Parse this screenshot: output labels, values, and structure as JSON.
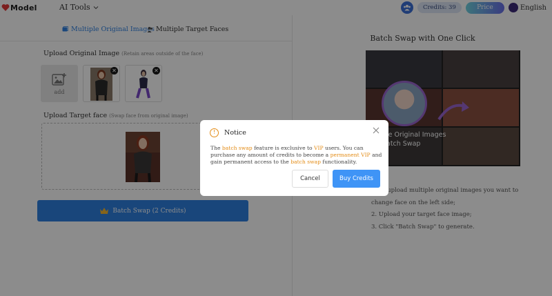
{
  "header": {
    "logo_text": "Model",
    "ai_tools_label": "AI Tools",
    "credits_label": "Credits: 39",
    "price_label": "Price",
    "language_label": "English"
  },
  "tabs": {
    "multiple_original": "Multiple Original Images",
    "multiple_target": "Multiple Target Faces"
  },
  "upload_original": {
    "title": "Upload Original Image",
    "hint": "(Retain areas outside of the face)",
    "add_label": "add"
  },
  "upload_target": {
    "title": "Upload Target face",
    "hint": "(Swap face from original image)"
  },
  "batch_button": {
    "label": "Batch Swap (2 Credits)"
  },
  "right_panel": {
    "title": "Batch Swap with One Click",
    "overlay_line1": "le Original Images",
    "overlay_line2": "atch Swap",
    "step1a": "se upload multiple original images you want to",
    "step1b": "change face on the left side;",
    "step2": "2. Upload your target face image;",
    "step3": "3. Click \"Batch Swap\" to generate."
  },
  "modal": {
    "title": "Notice",
    "t1": "The ",
    "h1": "batch swap",
    "t2": " feature is exclusive to ",
    "h2": "VIP",
    "t3": " users. You can purchase any amount of credits to become a ",
    "h3": "permanent VIP",
    "t4": " and gain permanent access to the ",
    "h4": "batch swap",
    "t5": " functionality.",
    "cancel_label": "Cancel",
    "buy_label": "Buy Credits"
  },
  "colors": {
    "accent_blue": "#2f80e0",
    "highlight_orange": "#e38b14",
    "buy_button": "#3f94f6"
  }
}
